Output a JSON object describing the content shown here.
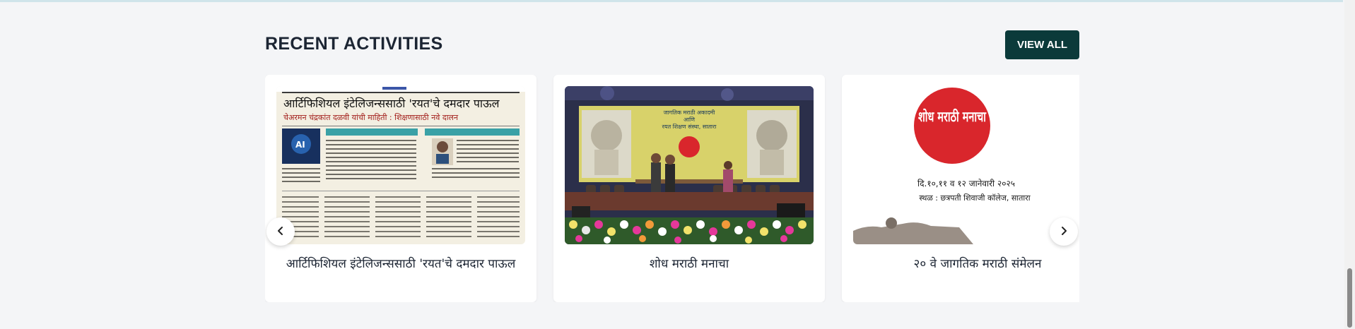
{
  "section": {
    "title": "RECENT ACTIVITIES",
    "view_all_label": "VIEW ALL"
  },
  "cards": [
    {
      "title": "आर्टिफिशियल इंटेलिजन्ससाठी 'रयत'चे दमदार पाऊल",
      "image": {
        "headline": "आर्टिफिशियल इंटेलिजन्ससाठी 'रयत'चे दमदार पाऊल",
        "subheadline": "चेअरमन चंद्रकांत दळवी यांची माहिती : शिक्षणासाठी नवे दालन",
        "badge": "AI"
      }
    },
    {
      "title": "शोध मराठी मनाचा",
      "image": {
        "banner_line1": "जागतिक मराठी अकादमी",
        "banner_line2": "आणि",
        "banner_line3": "रयत शिक्षण संस्था, सातारा"
      }
    },
    {
      "title": "२० वे जागतिक मराठी संमेलन",
      "image": {
        "logo_text": "शोध मराठी मनाचा",
        "date_line": "दि.१०,११ व १२ जानेवारी २०२५",
        "venue_line": "स्थळ : छत्रपती शिवाजी कॉलेज, सातारा"
      }
    }
  ],
  "nav": {
    "prev_icon": "chevron-left-icon",
    "next_icon": "chevron-right-icon"
  },
  "colors": {
    "page_bg": "#f4f5f7",
    "accent": "#0b3a3a",
    "title": "#1c2533",
    "logo_red": "#d9262c"
  }
}
